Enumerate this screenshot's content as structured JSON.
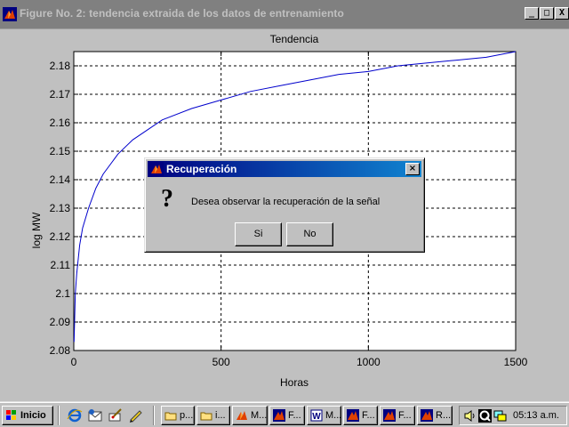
{
  "window": {
    "title": "Figure No. 2: tendencia extraida de los datos de entrenamiento",
    "minimize": "_",
    "maximize": "□",
    "close": "X"
  },
  "chart_data": {
    "type": "line",
    "title": "Tendencia",
    "xlabel": "Horas",
    "ylabel": "log MW",
    "xlim": [
      0,
      1500
    ],
    "ylim": [
      2.08,
      2.185
    ],
    "xticks": [
      0,
      500,
      1000,
      1500
    ],
    "xtick_labels": [
      "0",
      "500",
      "1000",
      "1500"
    ],
    "yticks": [
      2.08,
      2.09,
      2.1,
      2.11,
      2.12,
      2.13,
      2.14,
      2.15,
      2.16,
      2.17,
      2.18
    ],
    "ytick_labels": [
      "2.08",
      "2.09",
      "2.1",
      "2.11",
      "2.12",
      "2.13",
      "2.14",
      "2.15",
      "2.16",
      "2.17",
      "2.18"
    ],
    "grid": true,
    "line_color": "#0000cc",
    "series": [
      {
        "x": [
          1,
          5,
          10,
          20,
          30,
          50,
          75,
          100,
          150,
          200,
          300,
          400,
          500,
          600,
          700,
          800,
          900,
          1000,
          1100,
          1200,
          1300,
          1400,
          1500
        ],
        "values": [
          2.083,
          2.1,
          2.107,
          2.117,
          2.123,
          2.13,
          2.137,
          2.142,
          2.149,
          2.154,
          2.161,
          2.165,
          2.168,
          2.171,
          2.173,
          2.175,
          2.177,
          2.178,
          2.18,
          2.181,
          2.182,
          2.183,
          2.185
        ]
      }
    ]
  },
  "dialog": {
    "title": "Recuperación",
    "close": "×",
    "icon": "question-mark",
    "icon_glyph": "?",
    "message": "Desea observar la recuperación de la señal",
    "buttons": {
      "yes": "Si",
      "no": "No"
    }
  },
  "taskbar": {
    "start_label": "Inicio",
    "quick_launch": [
      "internet-explorer-icon",
      "outlook-express-icon",
      "paint-icon",
      "notepad-icon"
    ],
    "tasks": [
      {
        "label": "p...",
        "icon": "folder-icon"
      },
      {
        "label": "i...",
        "icon": "folder-icon"
      },
      {
        "label": "M...",
        "icon": "matlab-icon"
      },
      {
        "label": "F...",
        "icon": "matlab-figure-icon"
      },
      {
        "label": "M...",
        "icon": "word-icon"
      },
      {
        "label": "F...",
        "icon": "matlab-figure-icon"
      },
      {
        "label": "F...",
        "icon": "matlab-figure-icon"
      },
      {
        "label": "R...",
        "icon": "matlab-figure-icon"
      }
    ],
    "tray_icons": [
      "speaker-icon",
      "quicktime-icon",
      "network-icon"
    ],
    "clock": "05:13 a.m."
  }
}
